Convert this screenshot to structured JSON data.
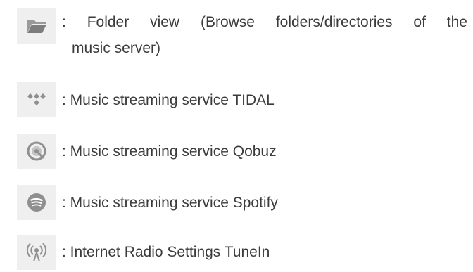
{
  "colors": {
    "icon_background": "#efefef",
    "icon_gray": "#8f8f8f",
    "text": "#3b3b3b"
  },
  "items": [
    {
      "icon": "folder-icon",
      "line1": ": Folder view (Browse folders/directories of the",
      "line2": "music server)"
    },
    {
      "icon": "tidal-icon",
      "text": ": Music streaming service TIDAL"
    },
    {
      "icon": "qobuz-icon",
      "text": ": Music streaming service Qobuz"
    },
    {
      "icon": "spotify-icon",
      "text": ": Music streaming service Spotify"
    },
    {
      "icon": "tunein-radio-icon",
      "text": ": Internet Radio Settings TuneIn"
    }
  ]
}
